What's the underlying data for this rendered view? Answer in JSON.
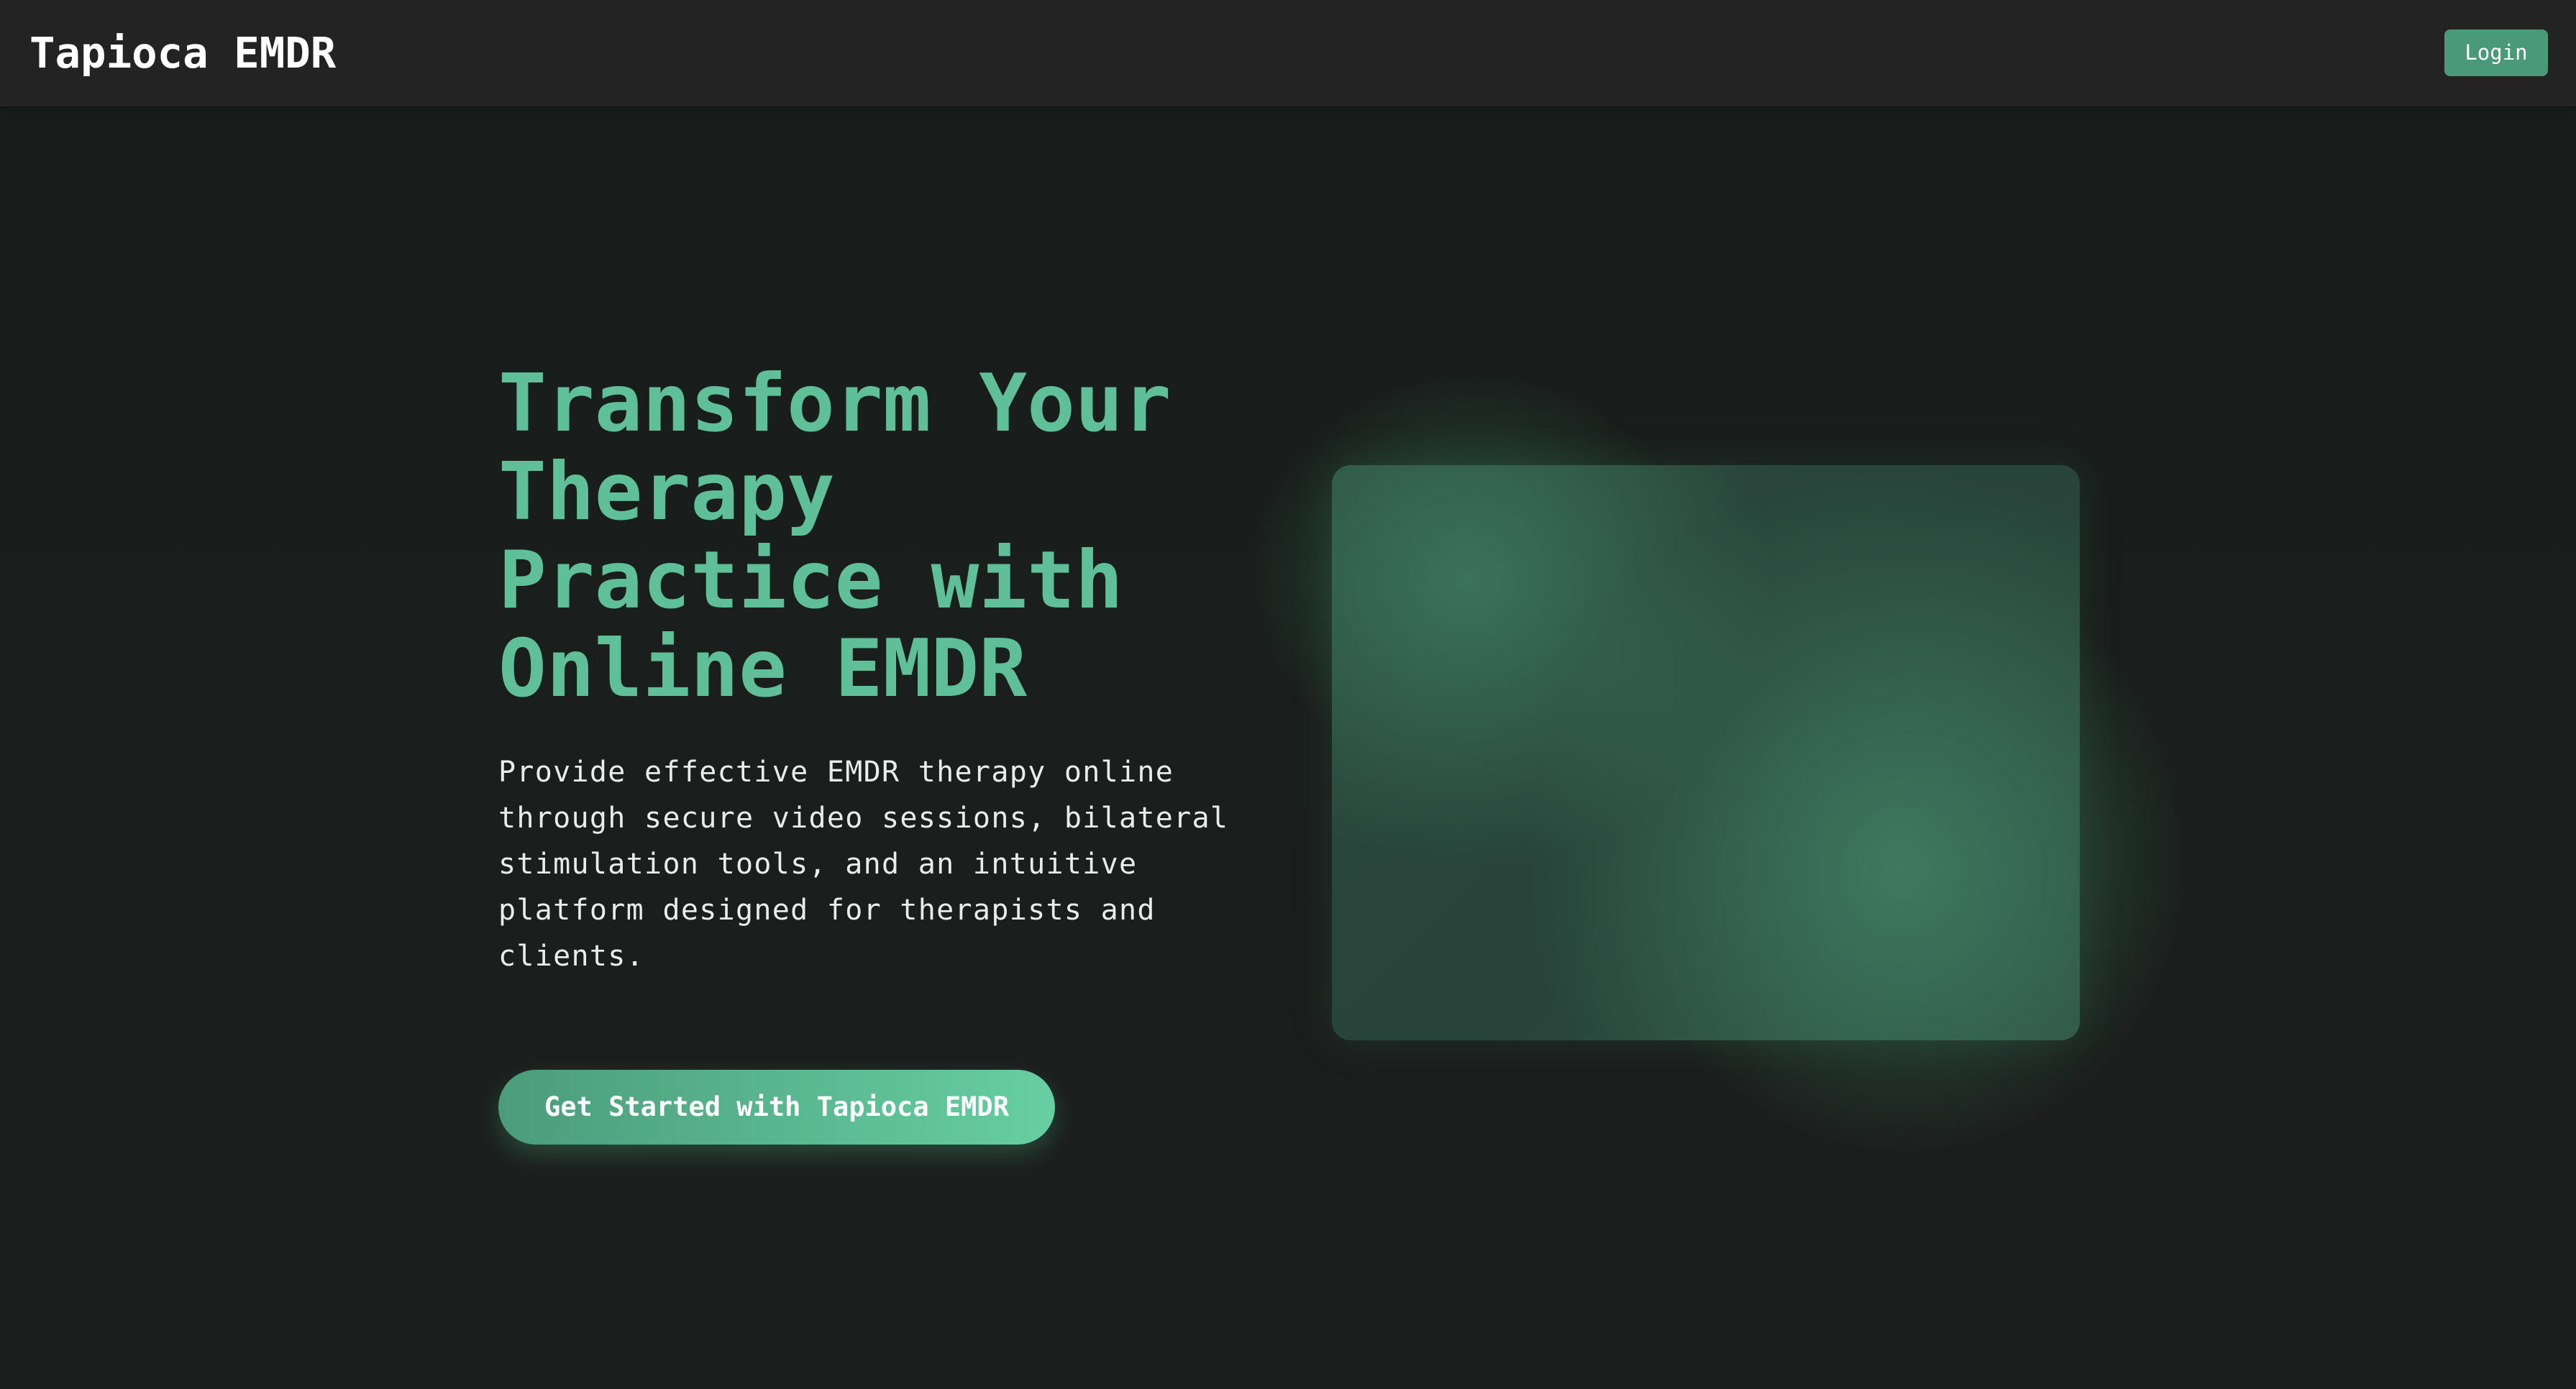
{
  "header": {
    "brand": "Tapioca EMDR",
    "login_label": "Login"
  },
  "hero": {
    "title_lines": [
      "Transform Your",
      "Therapy",
      "Practice with",
      "Online EMDR"
    ],
    "description_lines": [
      "Provide effective EMDR therapy online",
      "through secure video sessions, bilateral",
      "stimulation tools, and an intuitive",
      "platform designed for therapists and",
      "clients."
    ],
    "cta_label": "Get Started with Tapioca EMDR"
  },
  "colors": {
    "accent": "#5ebf98",
    "button": "#4a9a7a",
    "navbar": "#232323",
    "background": "#1a1c1b"
  }
}
